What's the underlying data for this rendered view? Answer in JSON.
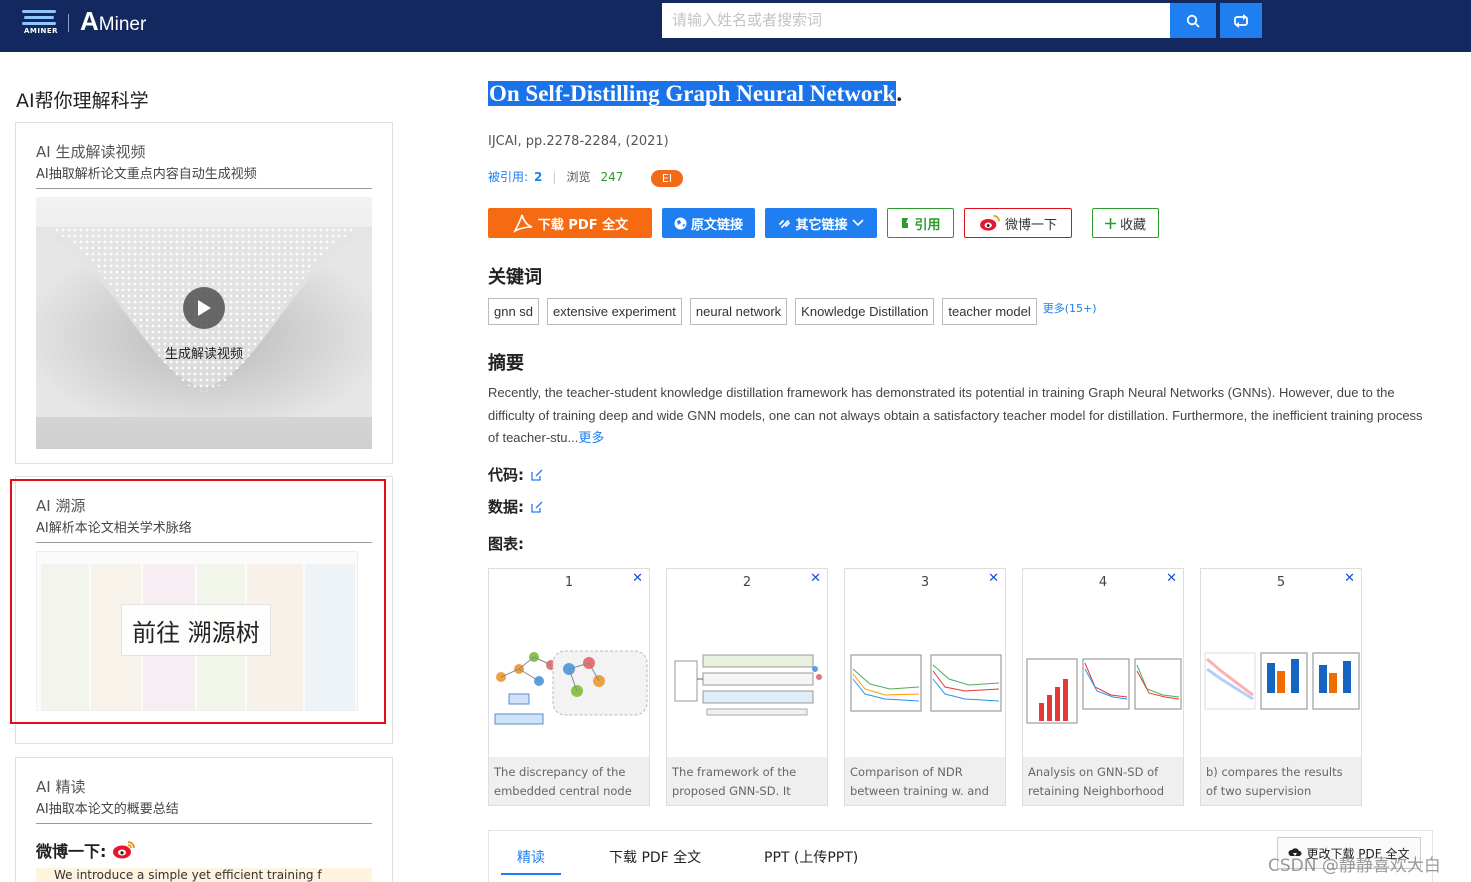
{
  "header": {
    "logo_small_text": "AMINER",
    "logo_brand": "Miner",
    "search_placeholder": "请输入姓名或者搜索词"
  },
  "left": {
    "section_title": "AI帮你理解科学",
    "video_card": {
      "title": "AI 生成解读视频",
      "subtitle": "AI抽取解析论文重点内容自动生成视频",
      "video_label": "生成解读视频"
    },
    "trace_card": {
      "title": "AI 溯源",
      "subtitle": "AI解析本论文相关学术脉络",
      "button": "前往 溯源树"
    },
    "read_card": {
      "title": "AI 精读",
      "subtitle": "AI抽取本论文的概要总结",
      "weibo_label": "微博一下:",
      "snippet": "We introduce a simple yet efficient training f"
    }
  },
  "paper": {
    "title": "On Self-Distilling Graph Neural Network",
    "title_suffix": ".",
    "venue": "IJCAI, pp.2278-2284, (2021)",
    "cited_label": "被引用:",
    "cited_count": "2",
    "views_label": "浏览",
    "views_count": "247",
    "badge": "EI"
  },
  "actions": {
    "pdf": "下载 PDF 全文",
    "source": "原文链接",
    "other": "其它链接",
    "cite": "引用",
    "weibo": "微博一下",
    "favorite": "收藏"
  },
  "keywords": {
    "heading": "关键词",
    "items": [
      "gnn sd",
      "extensive experiment",
      "neural network",
      "Knowledge Distillation",
      "teacher model"
    ],
    "more": "更多(15+)"
  },
  "abstract": {
    "heading": "摘要",
    "text": "Recently, the teacher-student knowledge distillation framework has demonstrated its potential in training Graph Neural Networks (GNNs). However, due to the difficulty of training deep and wide GNN models, one can not always obtain a satisfactory teacher model for distillation. Furthermore, the inefficient training process of teacher-stu...",
    "more": "更多"
  },
  "fields": {
    "code": "代码:",
    "data": "数据:",
    "figures": "图表:"
  },
  "figures": [
    {
      "num": "1",
      "caption": "The discrepancy of the embedded central node (red..."
    },
    {
      "num": "2",
      "caption": "The framework of the proposed GNN-SD. It consists..."
    },
    {
      "num": "3",
      "caption": "Comparison of NDR between training w. and wo"
    },
    {
      "num": "4",
      "caption": "Analysis on GNN-SD of retaining Neighborhood Disc..."
    },
    {
      "num": "5",
      "caption": "b) compares the results of two supervision scheme..."
    }
  ],
  "tabs": {
    "items": [
      "精读",
      "下载 PDF 全文",
      "PPT (上传PPT)"
    ],
    "more_download": "更改下载 PDF 全文"
  },
  "watermark": "CSDN @静静喜欢大白",
  "colors": {
    "header_bg": "#13285e",
    "accent_blue": "#1f7ff0",
    "pdf_orange": "#f66a12",
    "ei_orange": "#f06a1a",
    "highlight_red": "#e0101a",
    "green": "#2e9a2e"
  },
  "icons": [
    "search-icon",
    "swap-icon",
    "play-icon",
    "pdf-icon",
    "globe-icon",
    "link-icon",
    "chevron-down-icon",
    "quote-icon",
    "weibo-icon",
    "plus-icon",
    "edit-icon",
    "close-icon",
    "cloud-download-icon"
  ]
}
